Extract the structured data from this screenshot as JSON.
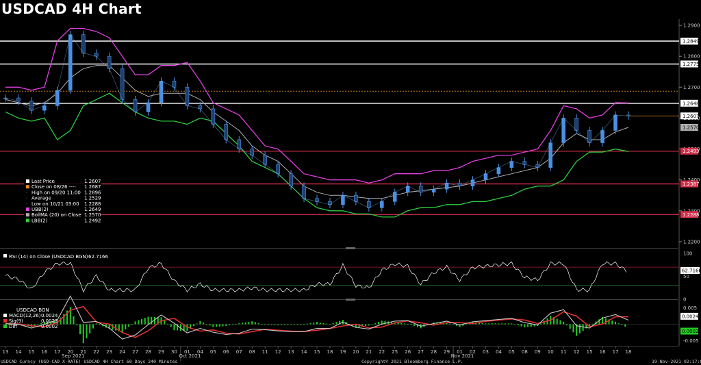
{
  "title": "USDCAD 4H Chart",
  "colors": {
    "bg": "#000000",
    "candle": "#4a90e2",
    "upper_band": "#e040e0",
    "mid_band": "#b0b0b0",
    "lower_band": "#2ecc40",
    "white_level": "#ffffff",
    "red_level": "#d0304a",
    "orange_level": "#e08a1a",
    "rsi_line": "#ffffff",
    "macd": "#c8c8c8",
    "signal": "#e03030",
    "diff": "#22cc22"
  },
  "legend": {
    "rows": [
      {
        "label": "Last Price",
        "value": "1.2607",
        "swatch": "#ffffff"
      },
      {
        "label": "Close on 08/26 ----",
        "value": "1.2687",
        "swatch": "#e08a1a"
      },
      {
        "label": "High on 09/20 11:00",
        "value": "1.2896",
        "swatch": ""
      },
      {
        "label": "Average",
        "value": "1.2529",
        "swatch": ""
      },
      {
        "label": "Low on 10/21 03:00",
        "value": "1.2288",
        "swatch": ""
      },
      {
        "label": "UBB(2)",
        "value": "1.2649",
        "swatch": "#e040e0"
      },
      {
        "label": "BollMA (20)  on Close",
        "value": "1.2570",
        "swatch": "#b0b0b0"
      },
      {
        "label": "LBB(2)",
        "value": "1.2492",
        "swatch": "#2ecc40"
      }
    ]
  },
  "price_axis": {
    "ticks": [
      "1.2900",
      "1.2800",
      "1.2700",
      "1.2600",
      "1.2500",
      "1.2400",
      "1.2300",
      "1.2200"
    ],
    "tag_labels": [
      "1.2849",
      "1.2775",
      "1.2648",
      "1.2607",
      "1.2570",
      "1.2493",
      "1.2387",
      "1.2288"
    ]
  },
  "rsi": {
    "label": "RSI (14)  on Close (USDCAD BGN)",
    "value": "62.7166",
    "ticks": [
      "100",
      "50",
      "0"
    ],
    "tag": "62.7166"
  },
  "macd": {
    "header": "USDCAD BGN",
    "rows": [
      {
        "label": "MACD(12,26)",
        "value": "0.0024",
        "swatch": "#ffffff"
      },
      {
        "label": "Sig(9)",
        "value": "0.0022",
        "swatch": "#e03030"
      },
      {
        "label": "Diff",
        "value": "0.0002",
        "swatch": "#22cc22"
      }
    ],
    "ticks": [
      "0.005",
      "-0.005"
    ],
    "tag_macd": "0.0024",
    "tag_diff": "0.0002"
  },
  "x_axis": {
    "days": [
      "13",
      "14",
      "15",
      "16",
      "17",
      "20",
      "21",
      "22",
      "23",
      "24",
      "27",
      "28",
      "29",
      "30",
      "01",
      "04",
      "05",
      "06",
      "07",
      "08",
      "11",
      "12",
      "13",
      "14",
      "15",
      "18",
      "19",
      "20",
      "21",
      "22",
      "25",
      "26",
      "27",
      "28",
      "29",
      "01",
      "02",
      "03",
      "04",
      "05",
      "08",
      "09",
      "10",
      "11",
      "12",
      "15",
      "16",
      "17",
      "18"
    ],
    "months": [
      "Sep 2021",
      "Oct 2021",
      "Nov 2021"
    ]
  },
  "footer": {
    "left": "USDCAD Curncy (USD-CAD X-RATE) USDCAD 4H Chart 60 Days 240 Minutes",
    "center": "Copyright© 2021 Bloomberg Finance L.P.",
    "right": "19-Nov-2021 02:17:04"
  },
  "chart_data": {
    "type": "line",
    "title": "USDCAD 4H Chart",
    "x": [
      "13",
      "14",
      "15",
      "16",
      "17",
      "20",
      "21",
      "22",
      "23",
      "24",
      "27",
      "28",
      "29",
      "30",
      "01",
      "04",
      "05",
      "06",
      "07",
      "08",
      "11",
      "12",
      "13",
      "14",
      "15",
      "18",
      "19",
      "20",
      "21",
      "22",
      "25",
      "26",
      "27",
      "28",
      "29",
      "01",
      "02",
      "03",
      "04",
      "05",
      "08",
      "09",
      "10",
      "11",
      "12",
      "15",
      "16",
      "17",
      "18"
    ],
    "ylim": [
      1.218,
      1.292
    ],
    "series": [
      {
        "values": [
          1.2665,
          1.2655,
          1.2625,
          1.264,
          1.269,
          1.287,
          1.281,
          1.28,
          1.276,
          1.266,
          1.262,
          1.265,
          1.272,
          1.27,
          1.264,
          1.263,
          1.258,
          1.253,
          1.25,
          1.248,
          1.245,
          1.242,
          1.238,
          1.234,
          1.233,
          1.232,
          1.235,
          1.233,
          1.231,
          1.233,
          1.236,
          1.238,
          1.236,
          1.237,
          1.239,
          1.238,
          1.24,
          1.242,
          1.244,
          1.246,
          1.245,
          1.244,
          1.252,
          1.26,
          1.256,
          1.252,
          1.256,
          1.261,
          1.2607
        ]
      },
      {
        "values": [
          1.27,
          1.27,
          1.269,
          1.27,
          1.285,
          1.289,
          1.289,
          1.288,
          1.286,
          1.28,
          1.274,
          1.274,
          1.277,
          1.277,
          1.278,
          1.272,
          1.265,
          1.263,
          1.261,
          1.256,
          1.251,
          1.25,
          1.246,
          1.242,
          1.241,
          1.24,
          1.24,
          1.24,
          1.239,
          1.24,
          1.242,
          1.242,
          1.242,
          1.243,
          1.243,
          1.244,
          1.246,
          1.247,
          1.248,
          1.248,
          1.249,
          1.25,
          1.256,
          1.264,
          1.263,
          1.26,
          1.261,
          1.265,
          1.2649
        ]
      },
      {
        "values": [
          1.266,
          1.265,
          1.264,
          1.265,
          1.268,
          1.273,
          1.276,
          1.277,
          1.277,
          1.273,
          1.269,
          1.267,
          1.268,
          1.268,
          1.268,
          1.266,
          1.262,
          1.259,
          1.256,
          1.251,
          1.248,
          1.246,
          1.242,
          1.238,
          1.236,
          1.235,
          1.235,
          1.2345,
          1.234,
          1.234,
          1.235,
          1.236,
          1.2365,
          1.237,
          1.2375,
          1.238,
          1.239,
          1.24,
          1.241,
          1.242,
          1.243,
          1.244,
          1.247,
          1.252,
          1.255,
          1.253,
          1.253,
          1.2555,
          1.257
        ]
      },
      {
        "values": [
          1.262,
          1.26,
          1.259,
          1.26,
          1.253,
          1.256,
          1.264,
          1.266,
          1.268,
          1.265,
          1.262,
          1.26,
          1.259,
          1.259,
          1.258,
          1.26,
          1.259,
          1.255,
          1.251,
          1.246,
          1.244,
          1.242,
          1.238,
          1.234,
          1.231,
          1.23,
          1.23,
          1.229,
          1.229,
          1.228,
          1.228,
          1.23,
          1.231,
          1.231,
          1.232,
          1.232,
          1.233,
          1.233,
          1.234,
          1.235,
          1.237,
          1.238,
          1.238,
          1.24,
          1.246,
          1.249,
          1.249,
          1.25,
          1.2492
        ]
      }
    ]
  }
}
